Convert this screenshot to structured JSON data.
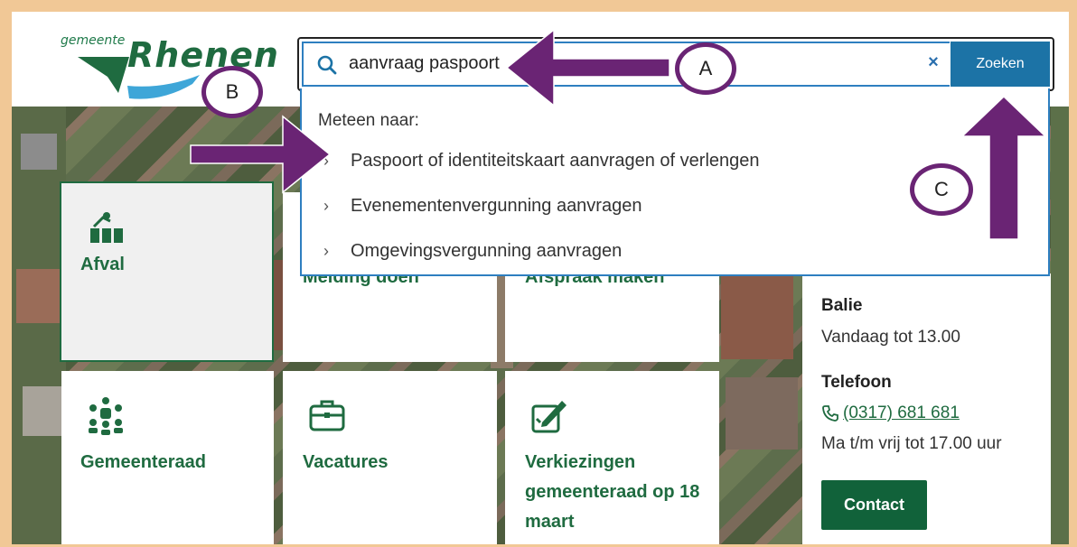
{
  "header": {
    "logo_small": "gemeente",
    "logo_big": "Rhenen"
  },
  "search": {
    "value": "aanvraag paspoort",
    "button_label": "Zoeken",
    "clear_symbol": "×"
  },
  "dropdown": {
    "heading": "Meteen naar:",
    "items": [
      {
        "label": "Paspoort of identiteitskaart aanvragen of verlengen"
      },
      {
        "label": "Evenementenvergunning aanvragen"
      },
      {
        "label": "Omgevingsvergunning aanvragen"
      }
    ]
  },
  "tiles": [
    {
      "label": "Afval",
      "icon": "trash-bins-icon"
    },
    {
      "label": "Melding doen",
      "icon": "report-icon"
    },
    {
      "label": "Afspraak maken",
      "icon": "calendar-icon"
    },
    {
      "label": "Gemeenteraad",
      "icon": "people-group-icon"
    },
    {
      "label": "Vacatures",
      "icon": "briefcase-icon"
    },
    {
      "label": "Verkiezingen gemeenteraad op 18 maart",
      "icon": "ballot-edit-icon"
    }
  ],
  "contact": {
    "balie_title": "Balie",
    "balie_text": "Vandaag tot 13.00",
    "telefoon_title": "Telefoon",
    "phone": "(0317) 681 681",
    "hours": "Ma t/m vrij tot 17.00 uur",
    "button_label": "Contact"
  },
  "annotations": {
    "a": "A",
    "b": "B",
    "c": "C"
  },
  "colors": {
    "brand_green": "#1f6b40",
    "search_blue": "#1c73a6",
    "annotation_purple": "#6a2474",
    "frame_tan": "#f1c896"
  }
}
